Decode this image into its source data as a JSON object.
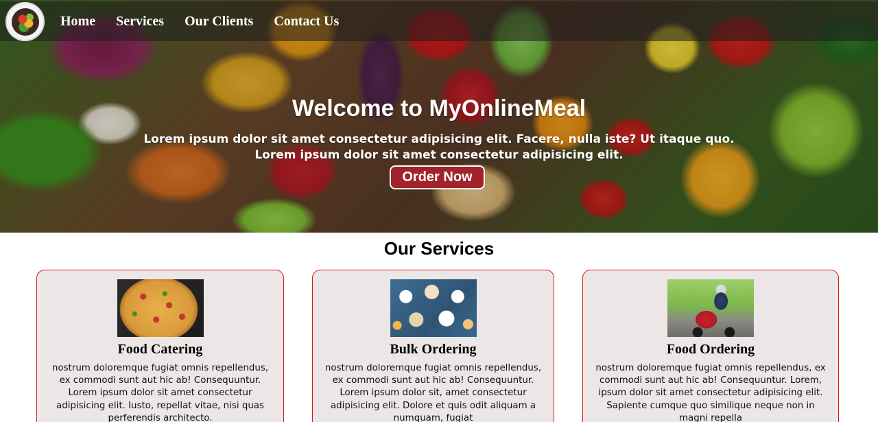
{
  "nav": {
    "logo_icon": "food-bowl-icon",
    "links": [
      {
        "label": "Home"
      },
      {
        "label": "Services"
      },
      {
        "label": "Our Clients"
      },
      {
        "label": "Contact Us"
      }
    ]
  },
  "hero": {
    "title": "Welcome to MyOnlineMeal",
    "subtitle_line1": "Lorem ipsum dolor sit amet consectetur adipisicing elit. Facere, nulla iste? Ut itaque quo.",
    "subtitle_line2": "Lorem ipsum dolor sit amet consectetur adipisicing elit.",
    "cta_label": "Order Now",
    "cta_color": "#a3232a"
  },
  "services": {
    "heading": "Our Services",
    "cards": [
      {
        "title": "Food Catering",
        "image": "pizza-image",
        "text": "nostrum doloremque fugiat omnis repellendus, ex commodi sunt aut hic ab! Consequuntur. Lorem ipsum dolor sit amet consectetur adipisicing elit. Iusto, repellat vitae, nisi quas perferendis architecto."
      },
      {
        "title": "Bulk Ordering",
        "image": "banquet-table-image",
        "text": "nostrum doloremque fugiat omnis repellendus, ex commodi sunt aut hic ab! Consequuntur. Lorem ipsum dolor sit, amet consectetur adipisicing elit. Dolore et quis odit aliquam a numquam, fugiat"
      },
      {
        "title": "Food Ordering",
        "image": "delivery-rider-image",
        "text": "nostrum doloremque fugiat omnis repellendus, ex commodi sunt aut hic ab! Consequuntur. Lorem, ipsum dolor sit amet consectetur adipisicing elit. Sapiente cumque quo similique neque non in magni repella"
      }
    ],
    "card_border_color": "#d31b1b",
    "card_background": "#ece6e6"
  }
}
